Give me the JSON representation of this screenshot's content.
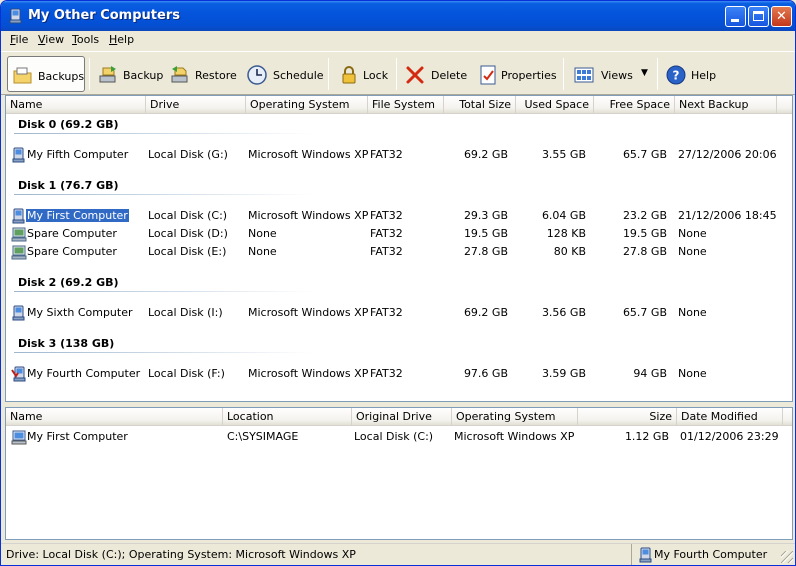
{
  "window": {
    "title": "My Other Computers"
  },
  "menu": [
    {
      "label": "File",
      "key": "F",
      "rest": "ile"
    },
    {
      "label": "View",
      "key": "V",
      "rest": "iew"
    },
    {
      "label": "Tools",
      "key": "T",
      "rest": "ools"
    },
    {
      "label": "Help",
      "key": "H",
      "rest": "elp"
    }
  ],
  "toolbar": {
    "backups": "Backups",
    "backup": "Backup",
    "restore": "Restore",
    "schedule": "Schedule",
    "lock": "Lock",
    "delete": "Delete",
    "properties": "Properties",
    "views": "Views",
    "help": "Help"
  },
  "top_columns": [
    "Name",
    "Drive",
    "Operating System",
    "File System",
    "Total Size",
    "Used Space",
    "Free Space",
    "Next Backup"
  ],
  "groups": [
    {
      "title": "Disk 0 (69.2 GB)",
      "rows": [
        {
          "name": "My Fifth Computer",
          "drive": "Local Disk (G:)",
          "os": "Microsoft Windows XP",
          "fs": "FAT32",
          "total": "69.2 GB",
          "used": "3.55 GB",
          "free": "65.7 GB",
          "next": "27/12/2006 20:06",
          "icon": "computer-icon"
        }
      ]
    },
    {
      "title": "Disk 1 (76.7 GB)",
      "rows": [
        {
          "name": "My First Computer",
          "drive": "Local Disk (C:)",
          "os": "Microsoft Windows XP",
          "fs": "FAT32",
          "total": "29.3 GB",
          "used": "6.04 GB",
          "free": "23.2 GB",
          "next": "21/12/2006 18:45",
          "icon": "computer-icon",
          "selected": true
        },
        {
          "name": "Spare Computer",
          "drive": "Local Disk (D:)",
          "os": "None",
          "fs": "FAT32",
          "total": "19.5 GB",
          "used": "128 KB",
          "free": "19.5 GB",
          "next": "None",
          "icon": "spare-computer-icon"
        },
        {
          "name": "Spare Computer",
          "drive": "Local Disk (E:)",
          "os": "None",
          "fs": "FAT32",
          "total": "27.8 GB",
          "used": "80 KB",
          "free": "27.8 GB",
          "next": "None",
          "icon": "spare-computer-icon"
        }
      ]
    },
    {
      "title": "Disk 2 (69.2 GB)",
      "rows": [
        {
          "name": "My Sixth Computer",
          "drive": "Local Disk (I:)",
          "os": "Microsoft Windows XP",
          "fs": "FAT32",
          "total": "69.2 GB",
          "used": "3.56 GB",
          "free": "65.7 GB",
          "next": "None",
          "icon": "computer-icon"
        }
      ]
    },
    {
      "title": "Disk 3 (138 GB)",
      "rows": [
        {
          "name": "My Fourth Computer",
          "drive": "Local Disk (F:)",
          "os": "Microsoft Windows XP",
          "fs": "FAT32",
          "total": "97.6 GB",
          "used": "3.59 GB",
          "free": "94 GB",
          "next": "None",
          "icon": "current-computer-icon"
        }
      ]
    }
  ],
  "bottom_columns": [
    "Name",
    "Location",
    "Original Drive",
    "Operating System",
    "Size",
    "Date Modified"
  ],
  "backups": [
    {
      "name": "My First Computer",
      "location": "C:\\SYSIMAGE",
      "drive": "Local Disk (C:)",
      "os": "Microsoft Windows XP",
      "size": "1.12 GB",
      "modified": "01/12/2006 23:29",
      "icon": "backup-image-icon"
    }
  ],
  "status": {
    "left": "Drive: Local Disk (C:); Operating System: Microsoft Windows XP",
    "right": "My Fourth Computer"
  },
  "colors": {
    "title_bar": "#0554dc",
    "selection": "#316ac5",
    "window_bg": "#ece9d8"
  }
}
